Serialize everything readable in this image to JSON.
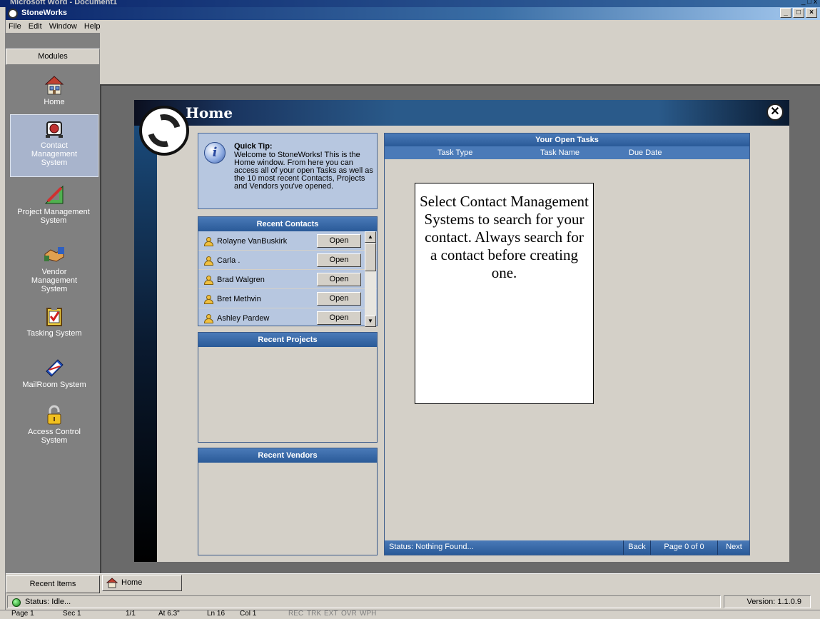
{
  "background_window": {
    "title": "Microsoft Word - Document1",
    "controls": "_ □ x"
  },
  "window": {
    "title": "StoneWorks",
    "controls": [
      "_",
      "□",
      "×"
    ]
  },
  "menu": [
    "File",
    "Edit",
    "Window",
    "Help"
  ],
  "sidebar": {
    "header": "Modules",
    "items": [
      {
        "label": "Home",
        "icon": "house-icon"
      },
      {
        "label": "Contact Management System",
        "icon": "rolodex-icon",
        "active": true
      },
      {
        "label": "Project Management System",
        "icon": "ruler-pencil-icon"
      },
      {
        "label": "Vendor Management System",
        "icon": "handshake-icon"
      },
      {
        "label": "Tasking System",
        "icon": "clipboard-check-icon"
      },
      {
        "label": "MailRoom System",
        "icon": "envelope-icon"
      },
      {
        "label": "Access Control System",
        "icon": "padlock-icon"
      }
    ]
  },
  "home_panel": {
    "title": "Home",
    "quick_tip": {
      "title": "Quick Tip:",
      "body": "Welcome to StoneWorks! This is the Home window. From here you can access all of your open Tasks as well as the 10 most recent Contacts, Projects and Vendors you've opened."
    },
    "recent_contacts": {
      "title": "Recent Contacts",
      "open_label": "Open",
      "items": [
        "Rolayne VanBuskirk",
        "Carla .",
        "Brad Walgren",
        "Bret Methvin",
        "Ashley Pardew"
      ]
    },
    "recent_projects": {
      "title": "Recent Projects"
    },
    "recent_vendors": {
      "title": "Recent Vendors"
    },
    "open_tasks": {
      "title": "Your Open Tasks",
      "columns": [
        "Task Type",
        "Task Name",
        "Due Date"
      ],
      "status": "Status: Nothing Found...",
      "back": "Back",
      "page": "Page 0 of 0",
      "next": "Next"
    },
    "callout": "Select Contact Management Systems to search for your contact. Always search for a contact before creating one."
  },
  "bottom": {
    "recent_items": "Recent Items",
    "tab_home": "Home",
    "status": "Status: Idle...",
    "version": "Version: 1.1.0.9"
  },
  "word_status": [
    "Page 1",
    "Sec 1",
    "1/1",
    "At 6.3\"",
    "Ln 16",
    "Col 1",
    "REC",
    "TRK",
    "EXT",
    "OVR",
    "WPH"
  ]
}
